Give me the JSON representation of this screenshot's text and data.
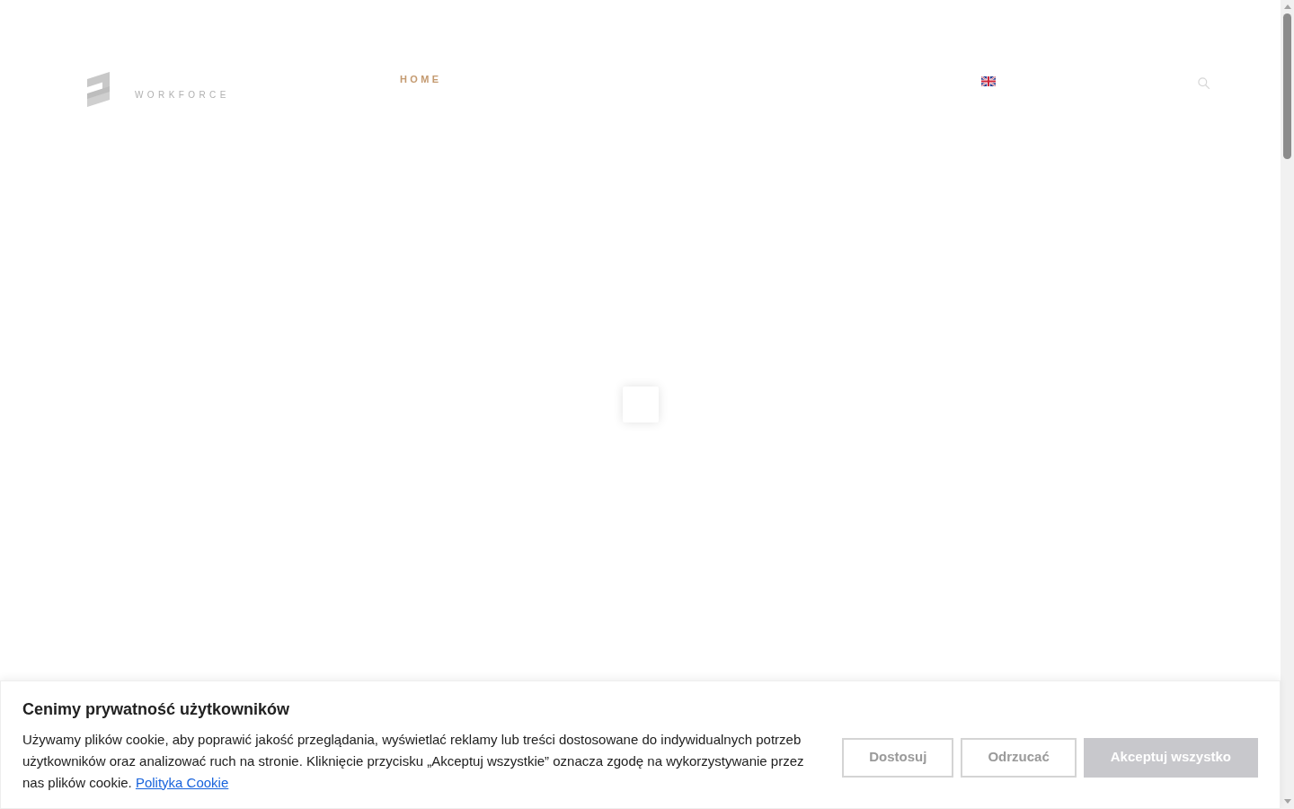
{
  "header": {
    "logo_text": "WORKFORCE",
    "nav": [
      {
        "label": "HOME",
        "selected": true
      }
    ]
  },
  "cookie_banner": {
    "title": "Cenimy prywatność użytkowników",
    "text": "Używamy plików cookie, aby poprawić jakość przeglądania, wyświetlać reklamy lub treści dostosowane do indywidualnych potrzeb użytkowników oraz analizować ruch na stronie. Kliknięcie przycisku „Akceptuj wszystkie” oznacza zgodę na wykorzystywanie przez nas plików cookie.",
    "link": "Polityka Cookie",
    "buttons": [
      {
        "label": "Dostosuj",
        "kind": "outline"
      },
      {
        "label": "Odrzucać",
        "kind": "outline"
      },
      {
        "label": "Akceptuj wszystko",
        "kind": "filled"
      }
    ]
  }
}
